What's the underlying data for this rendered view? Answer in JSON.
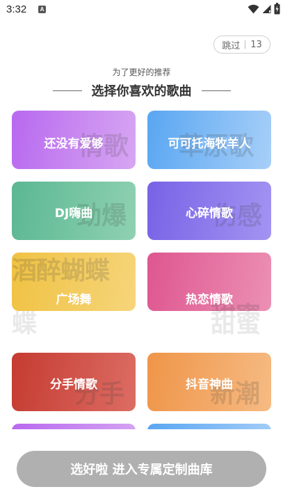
{
  "status_bar": {
    "time": "3:32",
    "notification_glyph": "A"
  },
  "skip": {
    "label": "跳过",
    "countdown": "13"
  },
  "header": {
    "subtitle": "为了更好的推荐",
    "title": "选择你喜欢的歌曲"
  },
  "genres": [
    {
      "label": "还没有爱够",
      "watermark": "情歌",
      "color_from": "#b869ef",
      "color_to": "#d7a6f2"
    },
    {
      "label": "可可托海牧羊人",
      "watermark": "草原歌",
      "color_from": "#59a6f2",
      "color_to": "#a7cff8"
    },
    {
      "label": "DJ嗨曲",
      "watermark": "劲爆",
      "color_from": "#5bb792",
      "color_to": "#8fd1b2"
    },
    {
      "label": "心碎情歌",
      "watermark": "伤感",
      "color_from": "#7862e6",
      "color_to": "#a394f2"
    },
    {
      "label": "广场舞",
      "watermark": "酒醉蝴蝶",
      "color_from": "#f0c243",
      "color_to": "#f6d57a"
    },
    {
      "label": "热恋情歌",
      "watermark": "甜蜜",
      "color_from": "#de5690",
      "color_to": "#ec90b4"
    },
    {
      "label": "分手情歌",
      "watermark": "分手",
      "color_from": "#c53b31",
      "color_to": "#dc6d64"
    },
    {
      "label": "抖音神曲",
      "watermark": "新潮",
      "color_from": "#ef9549",
      "color_to": "#f6bb83"
    },
    {
      "label": "",
      "watermark": "",
      "color_from": "#b869ef",
      "color_to": "#d7a6f2"
    },
    {
      "label": "",
      "watermark": "",
      "color_from": "#59a6f2",
      "color_to": "#a7cff8"
    }
  ],
  "cta": {
    "label": "选好啦 进入专属定制曲库",
    "color": "#b0b0b0"
  }
}
